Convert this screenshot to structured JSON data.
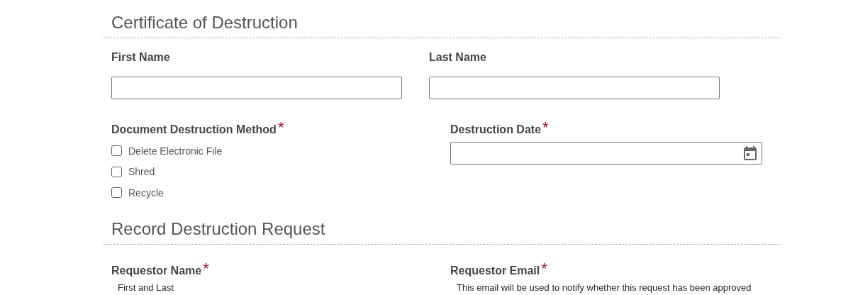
{
  "required_mark": "*",
  "sections": [
    {
      "title": "Certificate of Destruction",
      "rows": [
        {
          "fields": [
            {
              "kind": "text",
              "label": "First Name",
              "required": false
            },
            {
              "kind": "text",
              "label": "Last Name",
              "required": false
            }
          ]
        },
        {
          "fields": [
            {
              "kind": "checkboxes",
              "label": "Document Destruction Method",
              "required": true,
              "options": [
                {
                  "label": "Delete Electronic File",
                  "checked": false
                },
                {
                  "label": "Shred",
                  "checked": false
                },
                {
                  "label": "Recycle",
                  "checked": false
                }
              ]
            },
            {
              "kind": "date",
              "label": "Destruction Date",
              "required": true
            }
          ]
        }
      ]
    },
    {
      "title": "Record Destruction Request",
      "rows": [
        {
          "fields": [
            {
              "kind": "hint",
              "label": "Requestor Name",
              "required": true,
              "hint": "First and Last"
            },
            {
              "kind": "hint",
              "label": "Requestor Email",
              "required": true,
              "hint": "This email will be used to notify whether this request has been approved"
            }
          ]
        }
      ]
    }
  ]
}
